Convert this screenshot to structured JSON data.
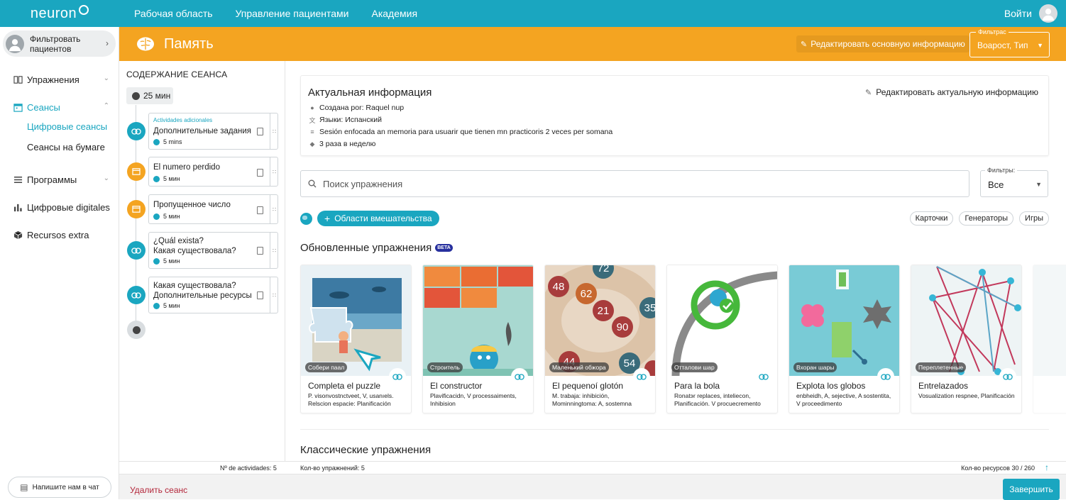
{
  "topbar": {
    "logo": "neuron",
    "nav": [
      "Рабочая область",
      "Управление пациентами",
      "Академия"
    ],
    "login": "Войти"
  },
  "sidebar": {
    "patient_filter": "Фильтровать пациентов",
    "items": [
      {
        "label": "Упражнения",
        "icon": "book-icon"
      },
      {
        "label": "Сеансы",
        "icon": "calendar-icon"
      },
      {
        "label": "Цифровые сеансы"
      },
      {
        "label": "Сеансы на бумаге"
      },
      {
        "label": "Программы",
        "icon": "list-icon"
      },
      {
        "label": "Цифровые digitales",
        "icon": "bar-chart-icon"
      },
      {
        "label": "Recursos extra",
        "icon": "box-icon"
      }
    ],
    "chat_button": "Напишите нам в чат"
  },
  "header": {
    "title": "Память",
    "edit_main": "Редактировать основную информацию",
    "filter_label": "Фильтрас",
    "filter_value": "Воарост, Тип"
  },
  "session": {
    "heading": "СОДЕРЖАНИЕ СЕАНСА",
    "duration": "25 мин",
    "activities": [
      {
        "tag": "Actividades adicionales",
        "line1": "Дополнительные задания",
        "line2": "",
        "mins": "5 mins",
        "dot": "teal"
      },
      {
        "tag": "",
        "line1": "El numero perdido",
        "line2": "",
        "mins": "5 мин",
        "dot": "orange"
      },
      {
        "tag": "",
        "line1": "Пропущенное число",
        "line2": "",
        "mins": "5 мин",
        "dot": "orange"
      },
      {
        "tag": "",
        "line1": "¿Quál existа?",
        "line2": "Какая существовала?",
        "mins": "5 мин",
        "dot": "teal"
      },
      {
        "tag": "",
        "line1": "Какая существовала?",
        "line2": "Дополнительные ресурсы",
        "mins": "5 мин",
        "dot": "teal"
      }
    ]
  },
  "info": {
    "title": "Актуальная информация",
    "edit": "Редактировать актуальную информацию",
    "created_by": "Создана por: Raquel nup",
    "languages": "Языки: Испанский",
    "description": "Sesión enfocada an memoria para usuarir que tienen mn practicoris 2 veces per somana",
    "frequency": "3 раза в неделю"
  },
  "search": {
    "placeholder": "Поиск упражнения"
  },
  "filters": {
    "label": "Фильтры:",
    "value": "Все"
  },
  "areas_button": "Области вмешательства",
  "chips": [
    "Карточки",
    "Генераторы",
    "Игры"
  ],
  "updated_section": {
    "title": "Обновленные упражнения",
    "badge": "BETA"
  },
  "exercises": [
    {
      "category": "Собери паал",
      "title": "Completa el puzzle",
      "desc": "P. visonvostnctveet, V, usanıels. Relscion espacie: Planificación"
    },
    {
      "category": "Строитель",
      "title": "El constructor",
      "desc": "Plavificacidn, V processaiments, Inhibisiоn"
    },
    {
      "category": "Маленький обжора",
      "title": "El pequenoí glotón",
      "desc": "M. trabaja: inhibición, Mominningtoma: A, sostemna"
    },
    {
      "category": "Отталови шар",
      "title": "Para la bola",
      "desc": "Ronatэr replaces, intelieсоn, Planificación. V procuecrеmento"
    },
    {
      "category": "Вхоран шары",
      "title": "Explota los globos",
      "desc": "enbheidh, A, sejective, A sostentita, V proceedimento"
    },
    {
      "category": "Переплетенные",
      "title": "Entrelazados",
      "desc": "Vosualization respnee, Planificación"
    }
  ],
  "numbers_bubbles": [
    "72",
    "48",
    "62",
    "21",
    "90",
    "35",
    "54",
    "44"
  ],
  "classic_section": {
    "title": "Классические упражнения"
  },
  "footer": {
    "activities_count": "Nº de actividades: 5",
    "exercises_count": "Кол-во упражнений: 5",
    "resources_count": "Кол-во ресурсов 30 / 260"
  },
  "bottom": {
    "delete": "Удалить сеанс",
    "finish": "Завершить"
  },
  "colors": {
    "primary": "#1aa6c0",
    "accent": "#f4a421",
    "danger": "#b3263a"
  }
}
